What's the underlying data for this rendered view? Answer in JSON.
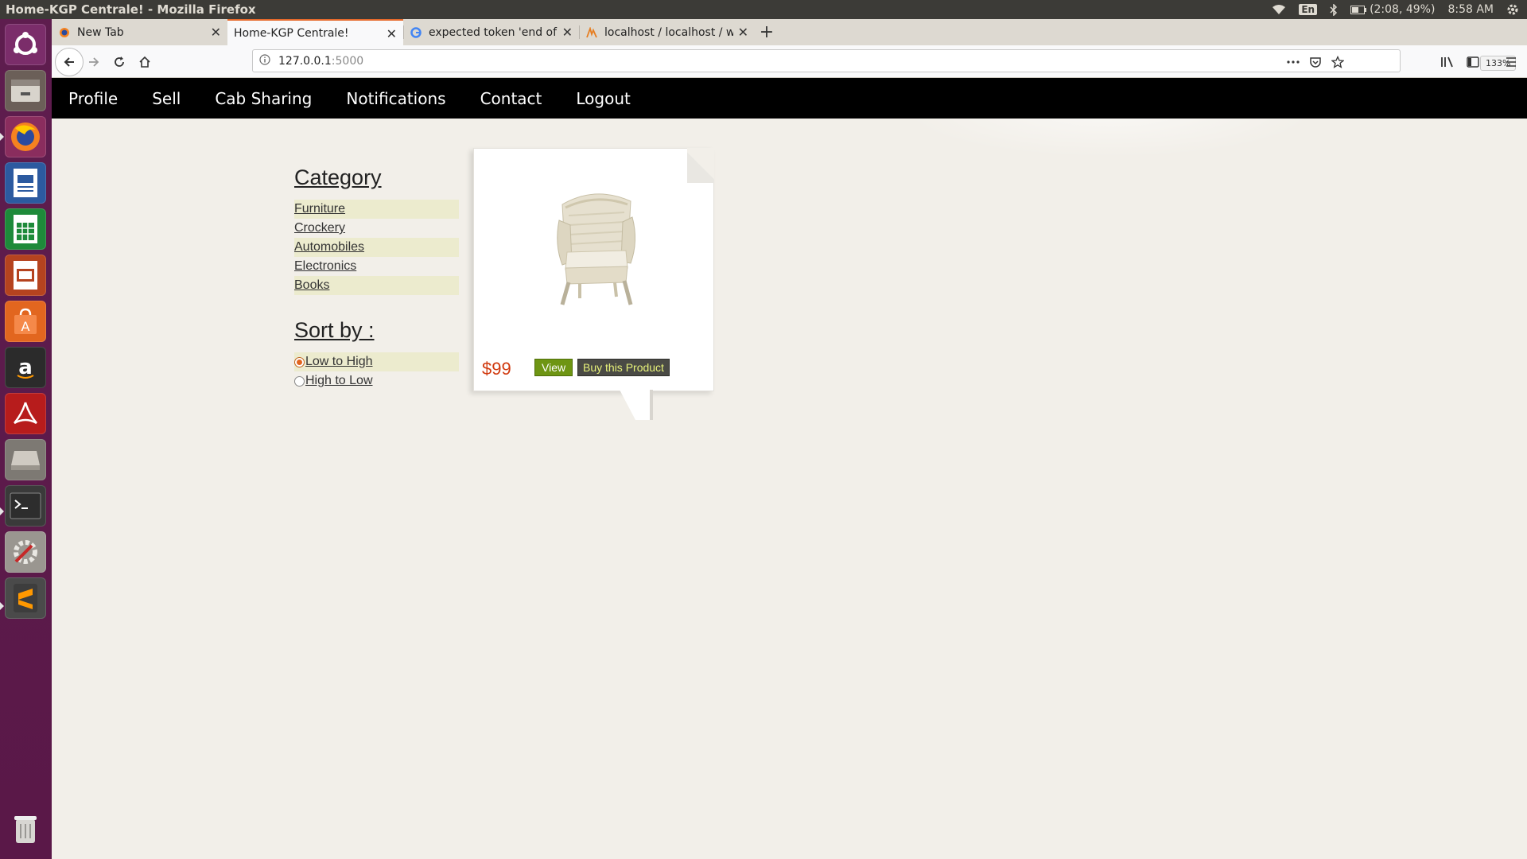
{
  "window": {
    "title": "Home-KGP Centrale! - Mozilla Firefox"
  },
  "system": {
    "keyboard": "En",
    "battery": "(2:08, 49%)",
    "time": "8:58 AM"
  },
  "launcher": {
    "apps": [
      "ubuntu-dash-icon",
      "files-icon",
      "firefox-icon",
      "writer-icon",
      "calc-icon",
      "impress-icon",
      "software-center-icon",
      "amazon-icon",
      "pdf-reader-icon",
      "disk-icon",
      "terminal-icon",
      "system-settings-icon",
      "sublime-text-icon",
      "trash-icon"
    ]
  },
  "browser": {
    "tabs": [
      {
        "label": "New Tab",
        "active": false
      },
      {
        "label": "Home-KGP Centrale!",
        "active": true
      },
      {
        "label": "expected token 'end of",
        "active": false
      },
      {
        "label": "localhost / localhost / w",
        "active": false
      }
    ],
    "url": {
      "host": "127.0.0.1",
      "port": ":5000"
    },
    "zoom": "133%"
  },
  "site": {
    "nav": [
      "Profile",
      "Sell",
      "Cab Sharing",
      "Notifications",
      "Contact",
      "Logout"
    ],
    "category_heading": "Category",
    "categories": [
      "Furniture",
      "Crockery",
      "Automobiles",
      "Electronics",
      "Books"
    ],
    "sort_heading": "Sort by :",
    "sort_options": [
      {
        "label": "Low to High",
        "selected": true
      },
      {
        "label": "High to Low",
        "selected": false
      }
    ],
    "product": {
      "price": "$99",
      "view_label": "View",
      "buy_label": "Buy this Product"
    }
  },
  "colors": {
    "nav_bg": "#000000",
    "page_bg": "#f2efe9",
    "price": "#d0390e",
    "view_btn": "#6e9513",
    "buy_btn": "#4a4a45",
    "active_tab_accent": "#e66a2c",
    "launcher_bg": "#5e1d4e"
  }
}
